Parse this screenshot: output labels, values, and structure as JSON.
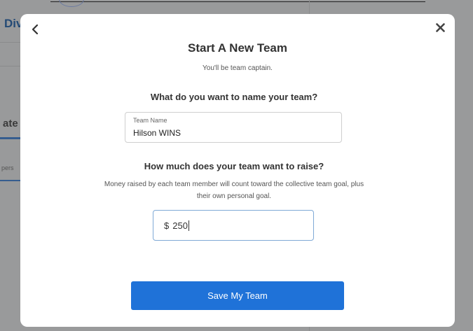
{
  "background": {
    "title_fragment": "Div",
    "tab_fragment": "ate",
    "small_fragment": "pers"
  },
  "modal": {
    "title": "Start A New Team",
    "subtitle": "You'll be team captain.",
    "name_question": "What do you want to name your team?",
    "name_field": {
      "label": "Team Name",
      "value": "Hilson WINS"
    },
    "goal_question": "How much does your team want to raise?",
    "goal_description": "Money raised by each team member will count toward the collective team goal, plus their own personal goal.",
    "amount_field": {
      "currency": "$",
      "value": "250"
    },
    "save_label": "Save My Team",
    "back_icon": "chevron-left-icon",
    "close_icon": "close-icon"
  },
  "colors": {
    "primary_button": "#1f72d8",
    "focused_border": "#7fa9d6",
    "overlay": "#999a9b"
  }
}
